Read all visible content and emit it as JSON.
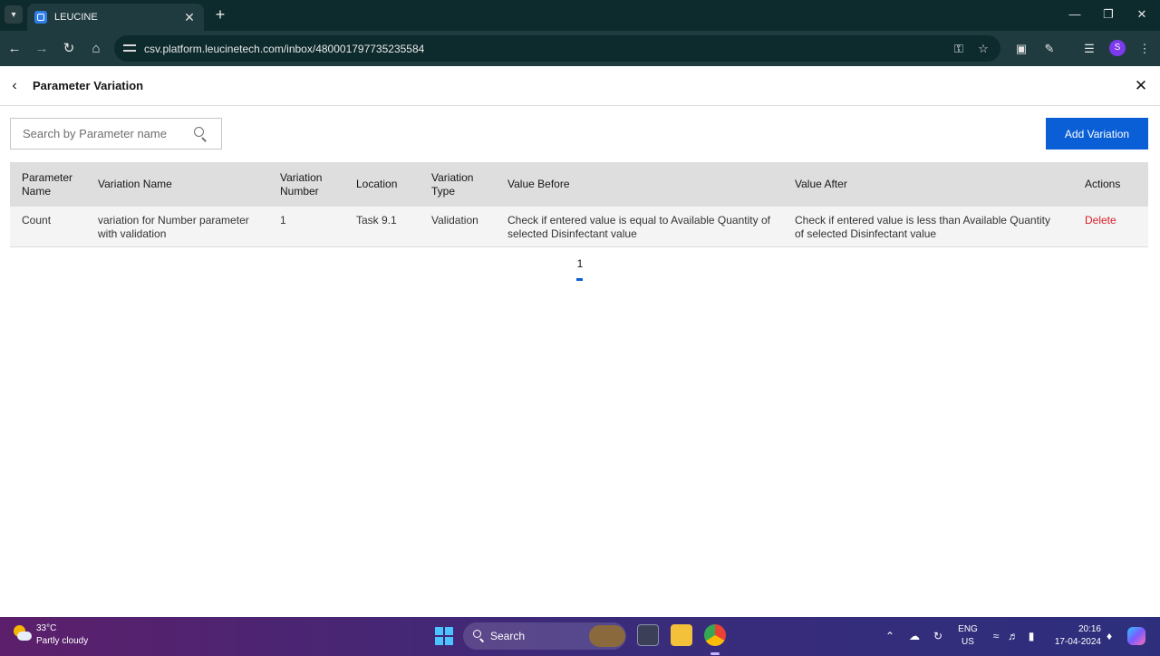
{
  "browser": {
    "tab_title": "LEUCINE",
    "url": "csv.platform.leucinetech.com/inbox/480001797735235584",
    "profile_initial": "S"
  },
  "header": {
    "title": "Parameter Variation"
  },
  "search": {
    "placeholder": "Search by Parameter name"
  },
  "add_button_label": "Add Variation",
  "table": {
    "columns": {
      "parameter_name": "Parameter Name",
      "variation_name": "Variation Name",
      "variation_number": "Variation Number",
      "location": "Location",
      "variation_type": "Variation Type",
      "value_before": "Value Before",
      "value_after": "Value After",
      "actions": "Actions"
    },
    "rows": [
      {
        "parameter_name": "Count",
        "variation_name": "variation for Number parameter with validation",
        "variation_number": "1",
        "location": "Task 9.1",
        "variation_type": "Validation",
        "value_before": "Check if entered value is equal to Available Quantity of selected Disinfectant value",
        "value_after": "Check if entered value is less than Available Quantity of selected Disinfectant value",
        "action": "Delete"
      }
    ]
  },
  "pagination": {
    "current_page": "1"
  },
  "taskbar": {
    "weather_temp": "33°C",
    "weather_desc": "Partly cloudy",
    "search_label": "Search",
    "lang_line1": "ENG",
    "lang_line2": "US",
    "time": "20:16",
    "date": "17-04-2024"
  },
  "colors": {
    "primary": "#0b5fd6",
    "danger": "#da1e28",
    "table_header_bg": "#dedede",
    "table_row_bg": "#f4f4f4",
    "browser_chrome": "#1f3b3f"
  }
}
